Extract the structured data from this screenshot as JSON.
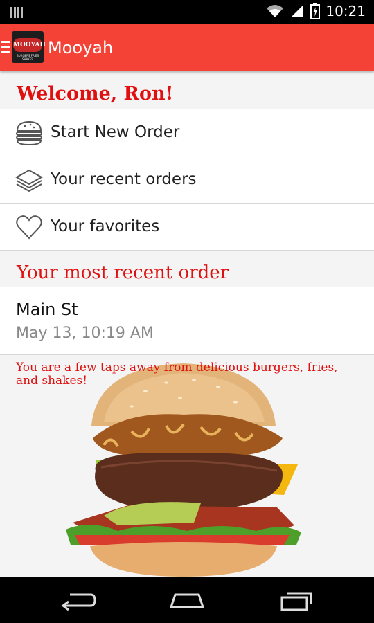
{
  "app": {
    "title": "Mooyah",
    "logo_text": "MOOYAH",
    "logo_tagline": "BURGERS FRIES SHAKES"
  },
  "status": {
    "time": "10:21"
  },
  "welcome": "Welcome, Ron!",
  "menu": [
    {
      "label": "Start New Order",
      "icon": "burger-icon"
    },
    {
      "label": "Your recent orders",
      "icon": "stack-icon"
    },
    {
      "label": "Your favorites",
      "icon": "heart-icon"
    }
  ],
  "recent_title": "Your most recent order",
  "recent_order": {
    "location": "Main St",
    "time": "May 13, 10:19 AM"
  },
  "promo": "You are a few taps away from delicious burgers, fries, and shakes!",
  "colors": {
    "brand": "#f44336",
    "accent": "#e01010"
  }
}
